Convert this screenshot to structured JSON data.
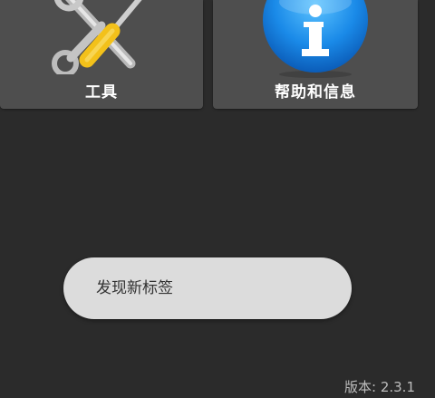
{
  "tiles": {
    "tools": {
      "label": "工具",
      "icon": "tools-icon"
    },
    "help": {
      "label": "帮助和信息",
      "icon": "info-icon"
    }
  },
  "toast": {
    "message": "发现新标签"
  },
  "footer": {
    "version": "版本: 2.3.1"
  },
  "colors": {
    "background": "#2b2b2b",
    "tile": "#4e4e4e",
    "toast": "#dcdcdc",
    "info_blue": "#1a8ae8",
    "screwdriver_yellow": "#f3c11a"
  }
}
